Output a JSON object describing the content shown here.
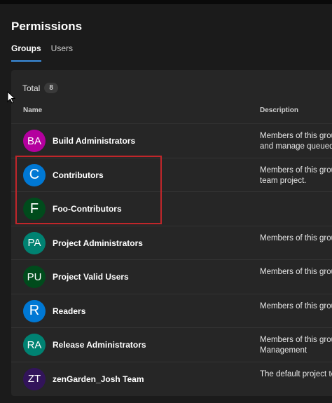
{
  "page": {
    "title": "Permissions"
  },
  "tabs": [
    {
      "label": "Groups",
      "active": true
    },
    {
      "label": "Users",
      "active": false
    }
  ],
  "summary": {
    "total_label": "Total",
    "total_count": "8"
  },
  "columns": {
    "name": "Name",
    "description": "Description"
  },
  "groups": [
    {
      "initials": "BA",
      "name": "Build Administrators",
      "description": "Members of this grou\nand manage queued",
      "color": "#b4009e"
    },
    {
      "initials": "C",
      "name": "Contributors",
      "description": "Members of this grou\nteam project.",
      "color": "#0078d4"
    },
    {
      "initials": "F",
      "name": "Foo-Contributors",
      "description": "",
      "color": "#004b1c"
    },
    {
      "initials": "PA",
      "name": "Project Administrators",
      "description": "Members of this grou",
      "color": "#008272"
    },
    {
      "initials": "PU",
      "name": "Project Valid Users",
      "description": "Members of this grou",
      "color": "#004b1c"
    },
    {
      "initials": "R",
      "name": "Readers",
      "description": "Members of this grou",
      "color": "#0078d4"
    },
    {
      "initials": "RA",
      "name": "Release Administrators",
      "description": "Members of this grou\nManagement",
      "color": "#008272"
    },
    {
      "initials": "ZT",
      "name": "zenGarden_Josh Team",
      "description": "The default project te",
      "color": "#32145a"
    }
  ],
  "colors": {
    "highlight": "#c0262a",
    "active_tab_underline": "#3b8fe0"
  }
}
